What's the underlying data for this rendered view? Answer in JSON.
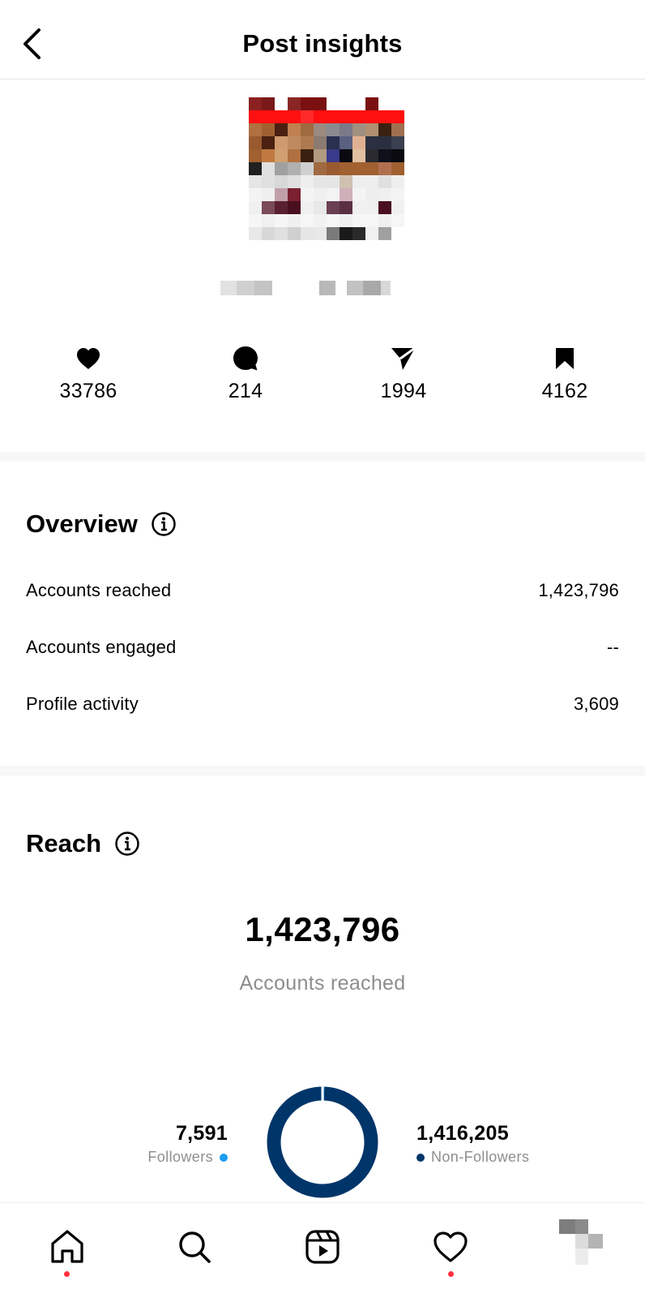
{
  "header": {
    "title": "Post insights",
    "back_icon": "chevron-left-icon"
  },
  "stats": [
    {
      "icon": "heart-icon",
      "value": "33786"
    },
    {
      "icon": "comment-icon",
      "value": "214"
    },
    {
      "icon": "share-icon",
      "value": "1994"
    },
    {
      "icon": "bookmark-icon",
      "value": "4162"
    }
  ],
  "overview": {
    "title": "Overview",
    "rows": [
      {
        "label": "Accounts reached",
        "value": "1,423,796"
      },
      {
        "label": "Accounts engaged",
        "value": "--"
      },
      {
        "label": "Profile activity",
        "value": "3,609"
      }
    ]
  },
  "reach": {
    "title": "Reach",
    "total": "1,423,796",
    "total_label": "Accounts reached",
    "followers": {
      "value": "7,591",
      "label": "Followers",
      "color": "#1c9bef"
    },
    "non_followers": {
      "value": "1,416,205",
      "label": "Non-Followers",
      "color": "#003569"
    },
    "followers_fraction": 0.0053
  },
  "tabbar": {
    "tabs": [
      "home-icon",
      "search-icon",
      "reels-icon",
      "activity-heart-icon",
      "profile-avatar"
    ],
    "notification_dot_color": "#ff3040"
  }
}
